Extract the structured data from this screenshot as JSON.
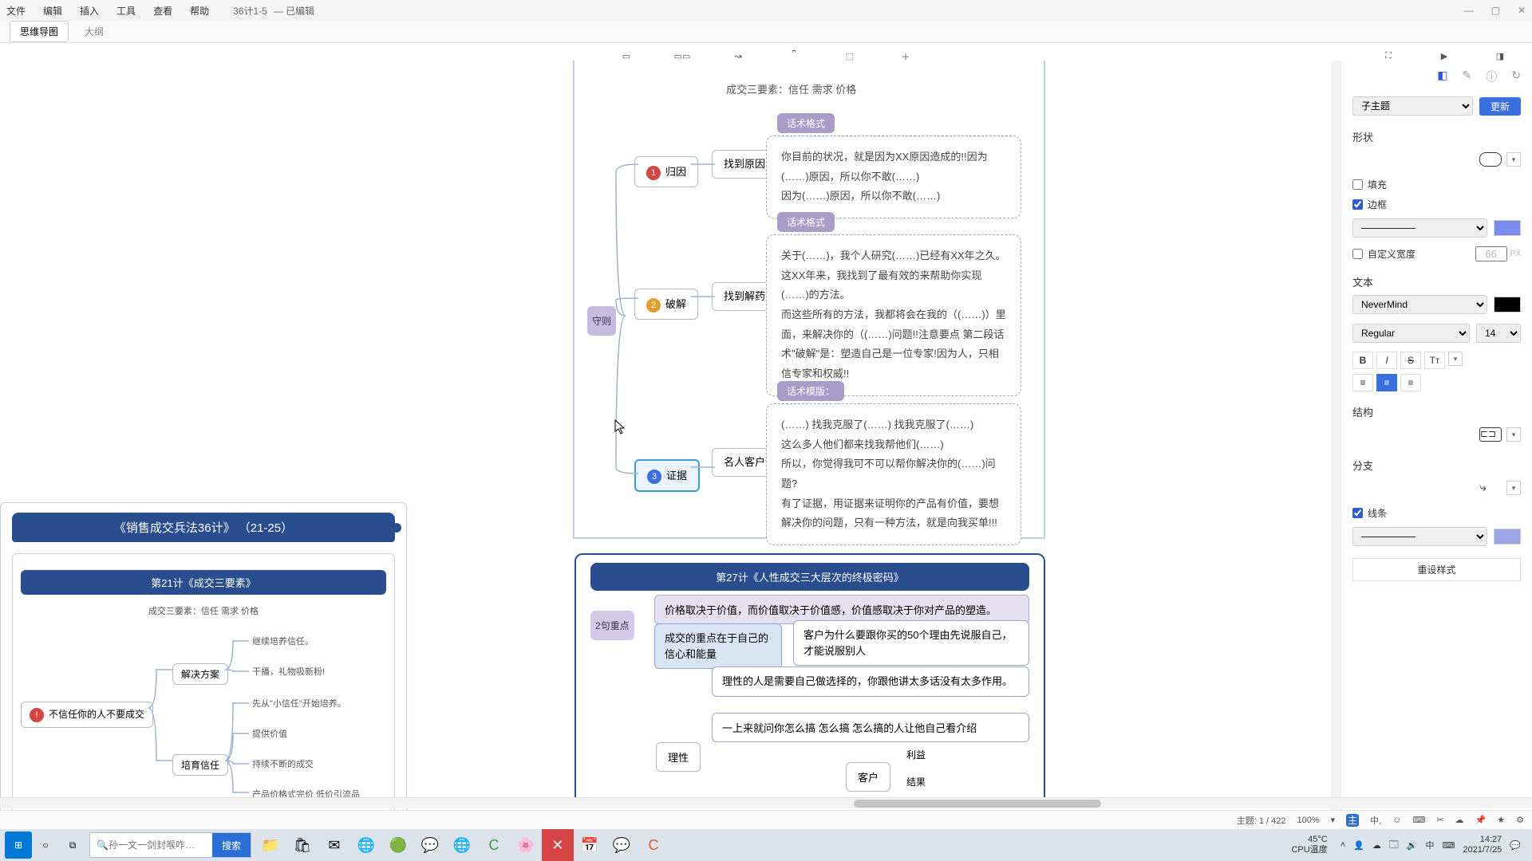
{
  "menu": {
    "file": "文件",
    "edit": "编辑",
    "insert": "插入",
    "tools": "工具",
    "view": "查看",
    "help": "帮助"
  },
  "docname": "36计1-5",
  "docstate": "— 已编辑",
  "subtabs": {
    "mindmap": "思维导图",
    "outline": "大纲"
  },
  "toolbar": {
    "theme": "主题",
    "subtopic": "子主题",
    "relation": "联系",
    "summary": "概要",
    "boundary": "外框",
    "insert": "插入",
    "zen": "ZEN",
    "present": "演示",
    "panel": "面板"
  },
  "sidebar": {
    "topictype": "子主题",
    "update": "更新",
    "shape": "形状",
    "fill": "填充",
    "border": "边框",
    "customwidth": "自定义宽度",
    "widthval": "66",
    "widthunit": "PX",
    "text": "文本",
    "font": "NeverMind",
    "weight": "Regular",
    "size": "14",
    "struct": "结构",
    "branch": "分支",
    "line": "线条",
    "reset": "重设样式"
  },
  "canvas": {
    "subtitle": "成交三要素：信任  需求  价格",
    "label_shouce": "守则",
    "steps": [
      {
        "num": "1",
        "title": "归因",
        "hint": "找到原因",
        "boxlabel": "话术格式",
        "body": "你目前的状况，就是因为XX原因造成的!!因为(……)原因，所以你不敢(……)\n因为(……)原因，所以你不敢(……)"
      },
      {
        "num": "2",
        "title": "破解",
        "hint": "找到解药",
        "boxlabel": "话术格式",
        "body": "关于(……)，我个人研究(……)已经有XX年之久。\n这XX年来，我找到了最有效的来帮助你实现(……)的方法。\n而这些所有的方法，我都将会在我的（(……)）里面，来解决你的（(……)问题!!注意要点 第二段话术\"破解\"是：塑造自己是一位专家!因为人，只相信专家和权威!!"
      },
      {
        "num": "3",
        "title": "证据",
        "hint": "名人客户证言",
        "boxlabel": "话术模版：",
        "body": "(……)  找我克服了(……)  找我克服了(……)\n这么多人他们都来找我帮他们(……)\n所以，你觉得我可不可以帮你解决你的(……)问题?\n有了证据，用证据来证明你的产品有价值，要想解决你的问题，只有一种方法，就是向我买单!!!"
      }
    ],
    "section27": {
      "title": "第27计《人性成交三大层次的终极密码》",
      "tag": "2句重点",
      "line1": "价格取决于价值，而价值取决于价值感，价值感取决于你对产品的塑造。",
      "line2": "成交的重点在于自己的信心和能量",
      "line2b": "客户为什么要跟你买的50个理由先说服自己，才能说服别人",
      "rational_a": "理性的人是需要自己做选择的，你跟他讲太多话没有太多作用。",
      "rational_b": "一上来就问你怎么搞 怎么搞 怎么搞的人让他自己看介绍",
      "n_rational": "理性",
      "n_customer": "客户",
      "n_benefit": "利益",
      "n_result": "结果"
    },
    "preview": {
      "hdr": "《销售成交兵法36计》 （21-25）",
      "sub": "第21计《成交三要素》",
      "tiny": "成交三要素：信任  需求  价格",
      "n1": "不信任你的人不要成交",
      "n2": "解决方案",
      "n3": "培育信任",
      "leaf": [
        "继续培养信任。",
        "干播，礼物吸新粉!",
        "先从\"小信任\"开始培养。",
        "提供价值",
        "持续不断的成交",
        "产品价格式完价 低价引流品"
      ]
    }
  },
  "status": {
    "topics": "主题: 1 / 422",
    "zoom": "100%"
  },
  "taskbar": {
    "searchPlaceholder": "孙一文一剑封喉咋…",
    "searchBtn": "搜索",
    "weather": {
      "temp": "45°C",
      "label": "CPU温度"
    },
    "time": "14:27",
    "date": "2021/7/25"
  }
}
